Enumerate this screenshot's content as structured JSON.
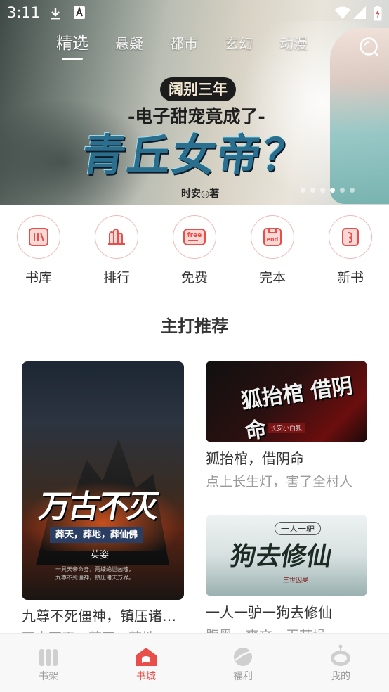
{
  "status_bar": {
    "time": "3:11"
  },
  "top_tabs": [
    "精选",
    "悬疑",
    "都市",
    "玄幻",
    "动漫"
  ],
  "banner": {
    "tag": "阔别三年",
    "subtitle": "-电子甜宠竟成了-",
    "title": "青丘女帝？",
    "author": "时安◎著",
    "slide_count": 6,
    "active_slide": 4
  },
  "categories": [
    {
      "label": "书库",
      "icon": "library-icon"
    },
    {
      "label": "排行",
      "icon": "ranking-icon"
    },
    {
      "label": "免费",
      "icon": "free-icon"
    },
    {
      "label": "完本",
      "icon": "completed-icon"
    },
    {
      "label": "新书",
      "icon": "new-book-icon"
    }
  ],
  "section_title": "主打推荐",
  "books": [
    {
      "name": "九尊不死僵神，镇压诸…",
      "desc": "万古不灭，葬天，葬地",
      "cover_title": "万古不灭",
      "cover_band": "葬天，葬地，葬仙佛",
      "cover_author": "英姿",
      "cover_line1": "一具天帝命身，两缕绝世凶魂，",
      "cover_line2": "九尊不死僵神，镇压诸天万界。"
    },
    {
      "name": "狐抬棺，借阴命",
      "desc": "点上长生灯，害了全村人",
      "cover_title": "狐抬棺 借阴命",
      "cover_small": "长安小白狐"
    },
    {
      "name": "一人一驴一狗去修仙",
      "desc": "腹黑，爽文，无节操",
      "cover_title": "狗去修仙",
      "cover_tag": "一人一驴",
      "cover_small": "三世因果"
    }
  ],
  "bottom_nav": [
    {
      "label": "书架",
      "icon": "bookshelf-icon",
      "active": false
    },
    {
      "label": "书城",
      "icon": "bookstore-icon",
      "active": true
    },
    {
      "label": "福利",
      "icon": "welfare-icon",
      "active": false
    },
    {
      "label": "我的",
      "icon": "profile-icon",
      "active": false
    }
  ],
  "colors": {
    "accent": "#e84f4a",
    "icon_ring": "#f0b9b5",
    "inactive": "#9a9a9a"
  }
}
